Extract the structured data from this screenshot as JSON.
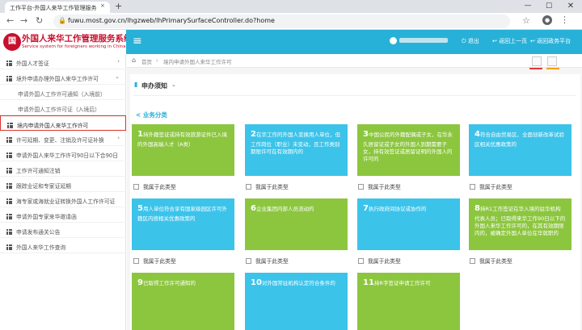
{
  "browser": {
    "tab_title": "工作平台-外国人来华工作管理服务",
    "tab_close": "×",
    "new_tab": "+",
    "url": "fuwu.most.gov.cn/lhgzweb/lhPrimarySurfaceController.do?home",
    "back": "←",
    "forward": "→",
    "reload": "↻",
    "min": "—",
    "max": "☐",
    "close": "✕",
    "star": "☆",
    "menu": "⋮"
  },
  "app": {
    "title": "外国人来华工作管理服务系统",
    "subtitle": "Service system for foreigners working in China",
    "logo_glyph": "国"
  },
  "header": {
    "menu_glyph": "≡",
    "links": [
      {
        "label": "退出"
      },
      {
        "label": "返回上一页"
      },
      {
        "label": "返回政务平台"
      }
    ]
  },
  "sidebar": {
    "items": [
      {
        "label": "外国人才签证",
        "type": "top",
        "arrow": "›"
      },
      {
        "label": "境外申请办理外国人来华工作许可",
        "type": "top",
        "arrow": "⌄"
      },
      {
        "label": "申请外国人工作许可通知（入境前）",
        "type": "sub"
      },
      {
        "label": "申请外国人工作许可证（入境后）",
        "type": "sub"
      },
      {
        "label": "境内申请外国人来华工作许可",
        "type": "active"
      },
      {
        "label": "许可延期、变更、注销及许可证补换",
        "type": "top",
        "arrow": "›"
      },
      {
        "label": "申请外国人来华工作许可90日以下合90日",
        "type": "top"
      },
      {
        "label": "工作许可通知注销",
        "type": "top"
      },
      {
        "label": "跟踪业证和专家证延期",
        "type": "top"
      },
      {
        "label": "海专家或海就业证转换外国人工作许可证",
        "type": "top"
      },
      {
        "label": "申请外国专家来华邀请函",
        "type": "top"
      },
      {
        "label": "申请发布通关公告",
        "type": "top"
      },
      {
        "label": "外国人来华工作查询",
        "type": "top"
      }
    ]
  },
  "breadcrumb": {
    "home": "首页",
    "sep": "›",
    "current": "境内申请外国人来华工作许可"
  },
  "notice": {
    "title": "申办须知",
    "chevron": "⌄"
  },
  "category": {
    "title": "< 业务分类"
  },
  "cards": [
    {
      "num": "1",
      "text": "持外籍签证或持有效旅游证件已入境的外国高端人才（A类）",
      "color": "green",
      "check": "我属于此类型"
    },
    {
      "num": "2",
      "text": "在华工作的外国人变换用人单位，但工作岗位（职业）未变动，且工作类别期限许可在有效期内的",
      "color": "blue",
      "check": "我属于此类型"
    },
    {
      "num": "3",
      "text": "中国公民的外籍配偶或子女，在华永久居留证或子女的外国人到期需要子女，持有效签证或居留证明的外国人的许可的",
      "color": "green",
      "check": "我属于此类型"
    },
    {
      "num": "4",
      "text": "符合自由贸易区、全面创新改革试验区相关优惠政策的",
      "color": "blue",
      "check": "我属于此类型"
    },
    {
      "num": "5",
      "text": "用人单位符合享有国家级园区许可外籍区内按相关优惠政策的",
      "color": "blue",
      "check": "我属于此类型"
    },
    {
      "num": "6",
      "text": "企业集团内部人员流动的",
      "color": "green",
      "check": "我属于此类型"
    },
    {
      "num": "7",
      "text": "执行政府间协议或协作的",
      "color": "blue",
      "check": "我属于此类型"
    },
    {
      "num": "8",
      "text": "持R1工作签证在华入境的驻华机构代表人员；已取得来华工作90日以下的外国人来华工作许可的，在其有效期限内的，被确定外国人单位在华就职的",
      "color": "green",
      "check": "我属于此类型"
    },
    {
      "num": "9",
      "text": "已取得工作许可通知的",
      "color": "green",
      "check": ""
    },
    {
      "num": "10",
      "text": "对外国常驻机构认定符合条件的",
      "color": "blue",
      "check": ""
    },
    {
      "num": "11",
      "text": "持R字签证申请工作许可",
      "color": "green",
      "check": ""
    }
  ],
  "colors": {
    "accent": "#28b1d8",
    "brand_red": "#c8102e",
    "card_green": "#8cc63f",
    "card_blue": "#3cc3ea",
    "active_border": "#d9342b"
  }
}
